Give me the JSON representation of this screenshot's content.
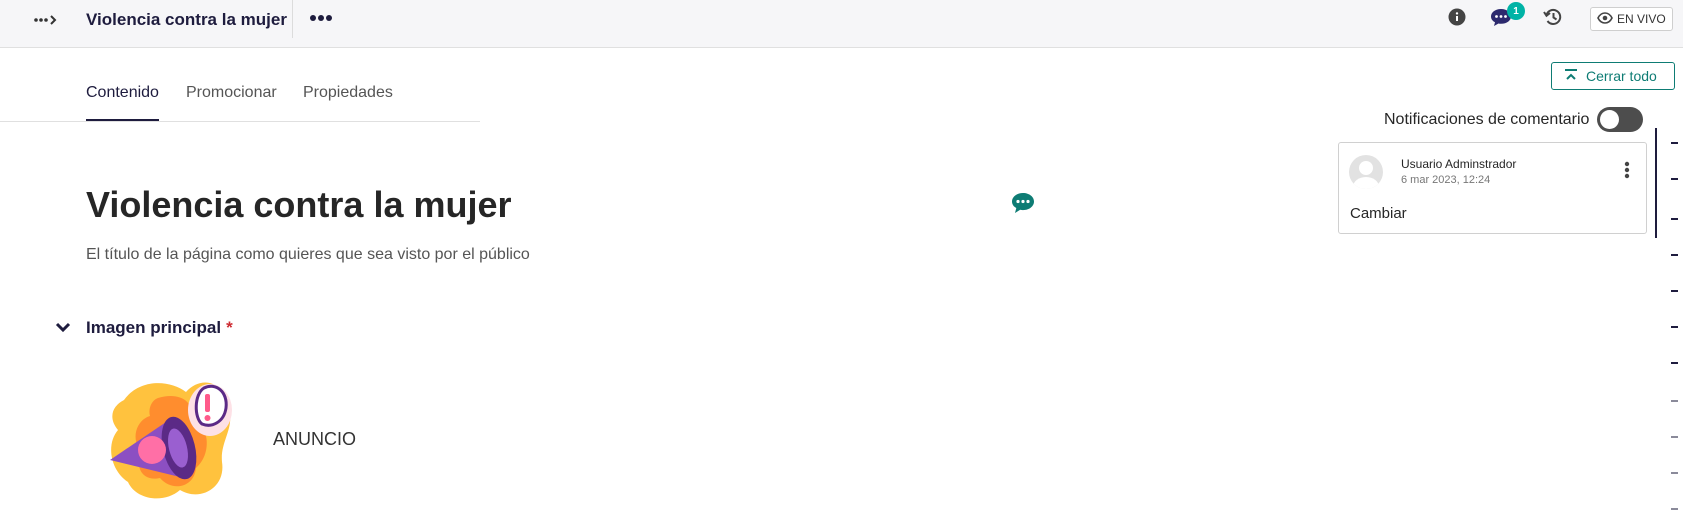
{
  "header": {
    "title": "Violencia contra la mujer",
    "comments_count": "1",
    "live_label": "EN VIVO"
  },
  "tabs": [
    {
      "label": "Contenido",
      "active": true
    },
    {
      "label": "Promocionar",
      "active": false
    },
    {
      "label": "Propiedades",
      "active": false
    }
  ],
  "main": {
    "title": "Violencia contra la mujer",
    "help_text": "El título de la página como quieres que sea visto por el público"
  },
  "section": {
    "title": "Imagen principal",
    "required_mark": "*",
    "image_caption": "ANUNCIO"
  },
  "comments": {
    "close_all_label": "Cerrar todo",
    "notifications_label": "Notificaciones de comentario",
    "notifications_on": false,
    "items": [
      {
        "author": "Usuario Adminstrador",
        "date": "6 mar 2023, 12:24",
        "text": "Cambiar"
      }
    ]
  },
  "colors": {
    "brand_dark": "#1e1c3e",
    "accent_teal": "#0e7c74",
    "badge_teal": "#00b3a6",
    "required_red": "#cd2b31"
  },
  "icons": {
    "breadcrumb_toggle": "ellipsis-arrow-icon",
    "more_actions": "horizontal-dots-icon",
    "info": "info-icon",
    "comments": "chat-bubble-icon",
    "history": "history-icon",
    "live": "eye-icon",
    "close_all": "collapse-up-icon",
    "add_comment": "chat-bubble-icon",
    "section_toggle": "chevron-down-icon",
    "comment_menu": "vertical-dots-icon"
  }
}
